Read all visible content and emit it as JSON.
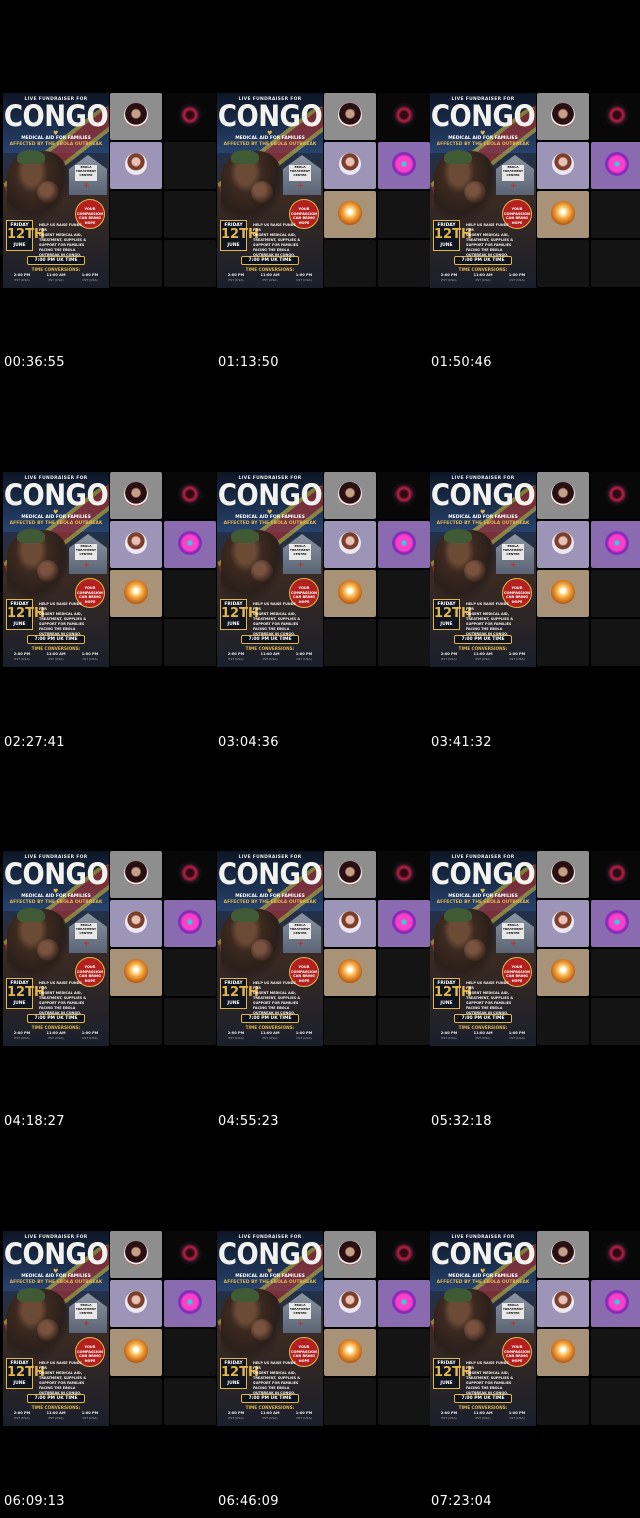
{
  "poster": {
    "top_line": "LIVE FUNDRAISER FOR",
    "title": "CONGO",
    "subtitle_1": "MEDICAL AID FOR FAMILIES",
    "subtitle_2": "AFFECTED BY THE EBOLA OUTBREAK",
    "sign_text": "EBOLA TREATMENT CENTER",
    "badge_text": "YOUR COMPASSION CAN BRING HOPE",
    "day": "FRIDAY",
    "date_number": "12TH",
    "month": "JUNE",
    "help_text": "HELP US RAISE FUNDS FOR\nURGENT MEDICAL AID,\nTREATMENT, SUPPLIES &\nSUPPORT FOR FAMILIES\nFACING THE EBOLA\nOUTBREAK IN CONGO.",
    "main_time": "7:00 PM UK TIME",
    "conversions_label": "TIME CONVERSIONS:",
    "zones": [
      {
        "time": "2:00 PM",
        "zone": "EST (USA)"
      },
      {
        "time": "11:00 AM",
        "zone": "PST (USA)"
      },
      {
        "time": "1:00 PM",
        "zone": "CST (USA)"
      }
    ]
  },
  "timestamps": [
    "00:36:55",
    "01:13:50",
    "01:50:46",
    "02:27:41",
    "03:04:36",
    "03:41:32",
    "04:18:27",
    "04:55:23",
    "05:32:18",
    "06:09:13",
    "06:46:09",
    "07:23:04"
  ],
  "avatar_icons": [
    "profile-avatar-icon",
    "woman-avatar-icon",
    "neon-globe-avatar-icon",
    "glowing-figure-avatar-icon",
    "dark-rose-avatar-icon"
  ]
}
